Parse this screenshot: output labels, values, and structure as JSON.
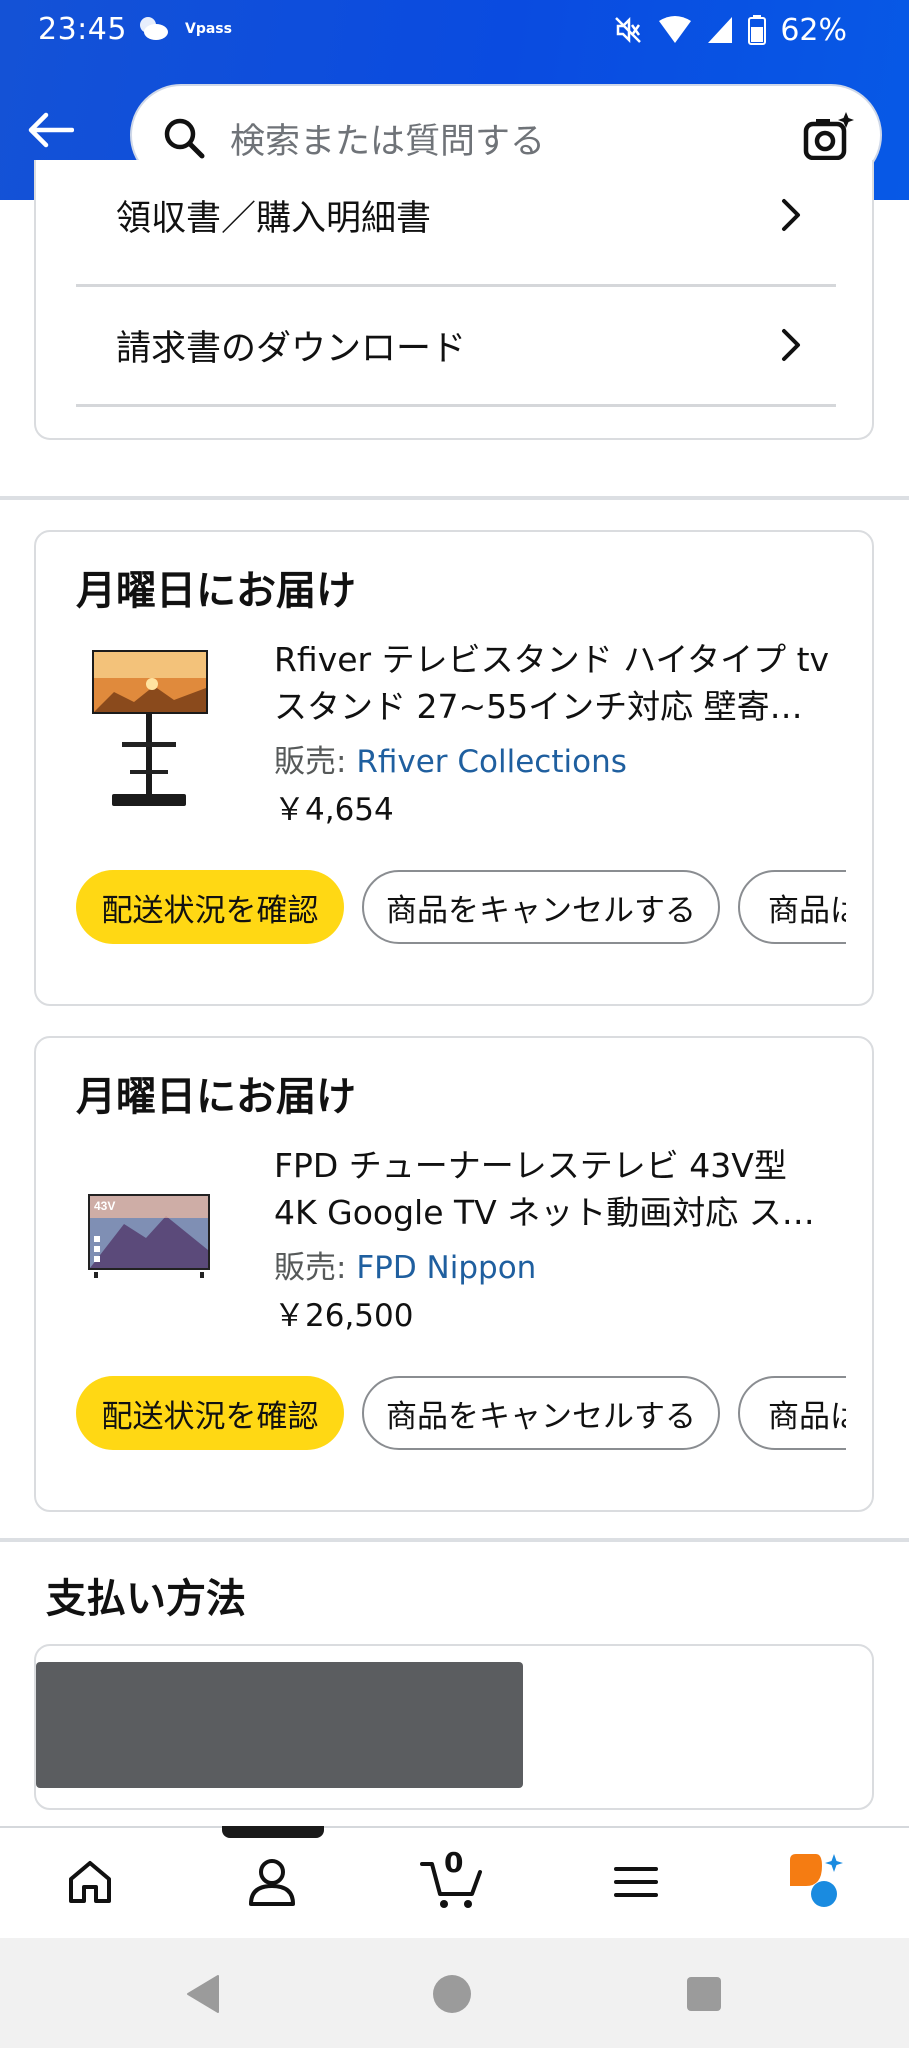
{
  "status_bar": {
    "time": "23:45",
    "app_label": "Vpass",
    "battery": "62%"
  },
  "search": {
    "placeholder": "検索または質問する"
  },
  "order_menu": {
    "items": [
      {
        "label": "領収書／購入明細書",
        "icon": "chevron-right-icon"
      },
      {
        "label": "請求書のダウンロード",
        "icon": "chevron-right-icon"
      }
    ]
  },
  "orders": [
    {
      "delivery": "月曜日にお届け",
      "product_name": "Rfiver テレビスタンド ハイタイプ tvスタンド 27~55インチ対応 壁寄…",
      "seller_prefix": "販売: ",
      "seller": "Rfiver Collections",
      "price": "￥4,654",
      "buttons": [
        "配送状況を確認",
        "商品をキャンセルする",
        "商品は"
      ]
    },
    {
      "delivery": "月曜日にお届け",
      "product_name": "FPD チューナーレステレビ 43V型 4K Google TV ネット動画対応 ス…",
      "seller_prefix": "販売: ",
      "seller": "FPD Nippon",
      "price": "￥26,500",
      "buttons": [
        "配送状況を確認",
        "商品をキャンセルする",
        "商品は"
      ],
      "thumb_badge": "43V"
    }
  ],
  "payment": {
    "title": "支払い方法"
  },
  "bottom_nav": {
    "items": [
      "home-icon",
      "account-icon",
      "cart-icon",
      "menu-icon",
      "rufus-icon"
    ],
    "cart_count": "0"
  },
  "colors": {
    "header": "#0a4be0",
    "primary_button": "#ffd814",
    "link": "#1f5f9f"
  }
}
